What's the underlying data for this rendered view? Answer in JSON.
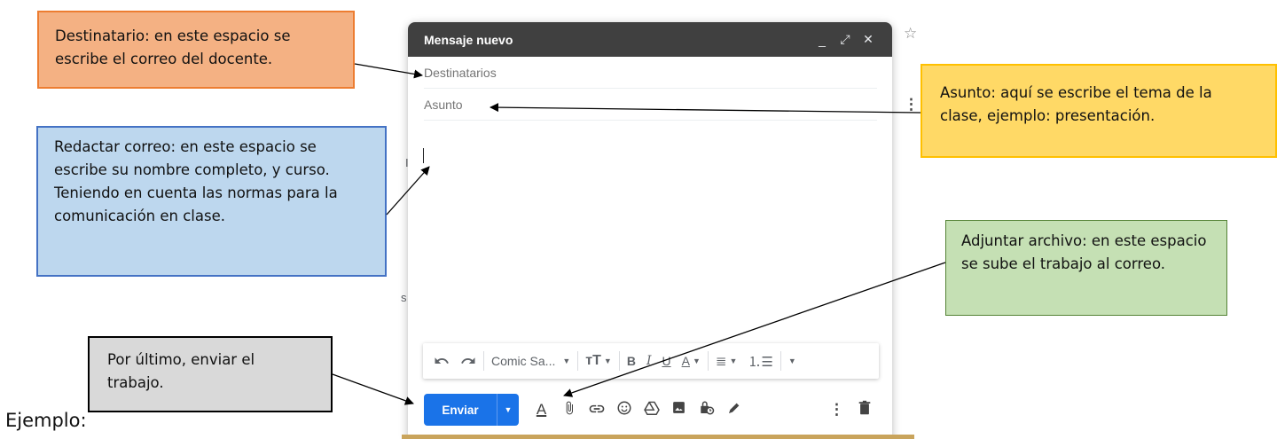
{
  "compose": {
    "title": "Mensaje nuevo",
    "minimize_glyph": "_",
    "expand_glyph": "⤢",
    "close_glyph": "✕",
    "to_placeholder": "Destinatarios",
    "subject_placeholder": "Asunto",
    "font_select": "Comic Sa...",
    "send_label": "Enviar",
    "icons": {
      "undo": "undo-icon",
      "redo": "redo-icon",
      "text_size": "text-size-icon",
      "bold": "B",
      "italic": "I",
      "underline": "U",
      "text_color": "A",
      "align": "align-icon",
      "numbered_list": "numbered-list-icon",
      "more_formatting": "more-icon",
      "formatting": "A",
      "attach": "paperclip-icon",
      "link": "link-icon",
      "emoji": "emoji-icon",
      "drive": "drive-icon",
      "photo": "photo-icon",
      "confidential": "lock-clock-icon",
      "signature": "pen-icon",
      "more_options": "more-vert-icon",
      "discard": "trash-icon"
    }
  },
  "annotations": {
    "destinatario": "Destinatario: en este espacio se escribe el correo del docente.",
    "asunto": "Asunto: aquí se escribe el tema de la clase, ejemplo: presentación.",
    "redactar": "Redactar correo: en este espacio se escribe su nombre completo, y curso. Teniendo en cuenta las normas para la comunicación en clase.",
    "adjuntar": "Adjuntar archivo: en este espacio se sube el trabajo al correo.",
    "ultimo": "Por último, enviar el trabajo."
  },
  "footer_label": "Ejemplo:",
  "background_fragments": {
    "star": "☆",
    "dots": "⋮",
    "i": "I",
    "s": "s"
  },
  "colors": {
    "header_bg": "#404040",
    "send_button": "#1a73e8",
    "destinatario_box": "#f4b183",
    "asunto_box": "#ffd966",
    "redactar_box": "#bdd7ee",
    "adjuntar_box": "#c5e0b4",
    "ultimo_box": "#d9d9d9"
  }
}
